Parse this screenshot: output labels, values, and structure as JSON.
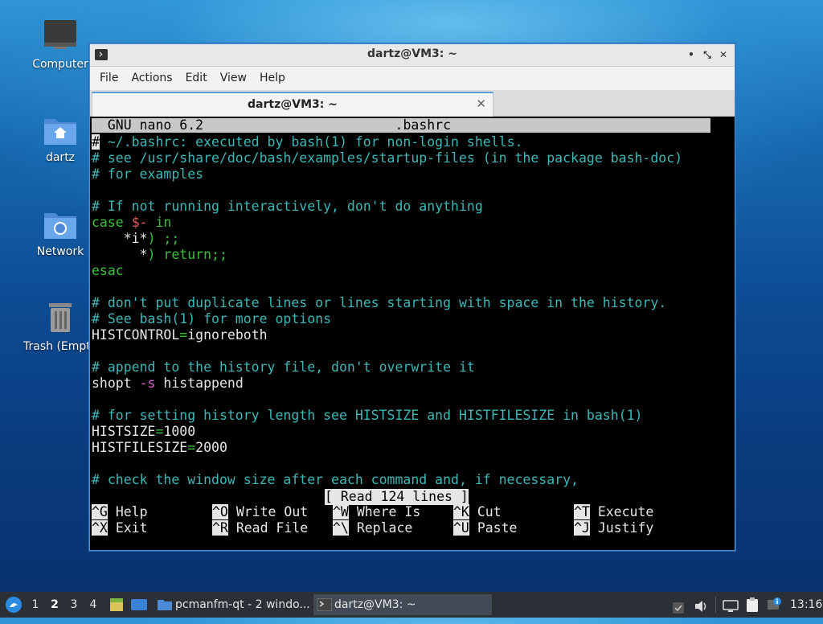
{
  "desktop": {
    "icons": [
      {
        "label": "Computer"
      },
      {
        "label": "dartz"
      },
      {
        "label": "Network"
      },
      {
        "label": "Trash (Empty)"
      }
    ]
  },
  "window": {
    "title": "dartz@VM3: ~",
    "controls": {
      "minimize": "•",
      "restore": "⤡",
      "close": "✕"
    },
    "menu": [
      "File",
      "Actions",
      "Edit",
      "View",
      "Help"
    ],
    "tab": {
      "title": "dartz@VM3: ~",
      "close": "✕"
    }
  },
  "nano": {
    "header_left": "GNU nano 6.2",
    "header_file": ".bashrc",
    "lines": [
      "# ~/.bashrc: executed by bash(1) for non-login shells.",
      "# see /usr/share/doc/bash/examples/startup-files (in the package bash-doc)",
      "# for examples",
      "",
      "# If not running interactively, don't do anything",
      "case $- in",
      "    *i*) ;;",
      "      *) return;;",
      "esac",
      "",
      "# don't put duplicate lines or lines starting with space in the history.",
      "# See bash(1) for more options",
      "HISTCONTROL=ignoreboth",
      "",
      "# append to the history file, don't overwrite it",
      "shopt -s histappend",
      "",
      "# for setting history length see HISTSIZE and HISTFILESIZE in bash(1)",
      "HISTSIZE=1000",
      "HISTFILESIZE=2000",
      "",
      "# check the window size after each command and, if necessary,"
    ],
    "status": "[ Read 124 lines ]",
    "shortcuts": [
      {
        "key": "^G",
        "label": "Help"
      },
      {
        "key": "^O",
        "label": "Write Out"
      },
      {
        "key": "^W",
        "label": "Where Is"
      },
      {
        "key": "^K",
        "label": "Cut"
      },
      {
        "key": "^T",
        "label": "Execute"
      },
      {
        "key": "^X",
        "label": "Exit"
      },
      {
        "key": "^R",
        "label": "Read File"
      },
      {
        "key": "^\\",
        "label": "Replace"
      },
      {
        "key": "^U",
        "label": "Paste"
      },
      {
        "key": "^J",
        "label": "Justify"
      }
    ],
    "colors": {
      "comment": "#3fb6b6",
      "keyword": "#3cbf3c",
      "variable": "#e05a5a",
      "option": "#e05fd0"
    }
  },
  "taskbar": {
    "workspaces": [
      "1",
      "2",
      "3",
      "4"
    ],
    "active_workspace": "2",
    "tasks": [
      {
        "label": "pcmanfm-qt - 2 windo...",
        "icon": "folder-icon"
      },
      {
        "label": "dartz@VM3: ~",
        "icon": "terminal-icon"
      }
    ],
    "clock": "13:16"
  }
}
